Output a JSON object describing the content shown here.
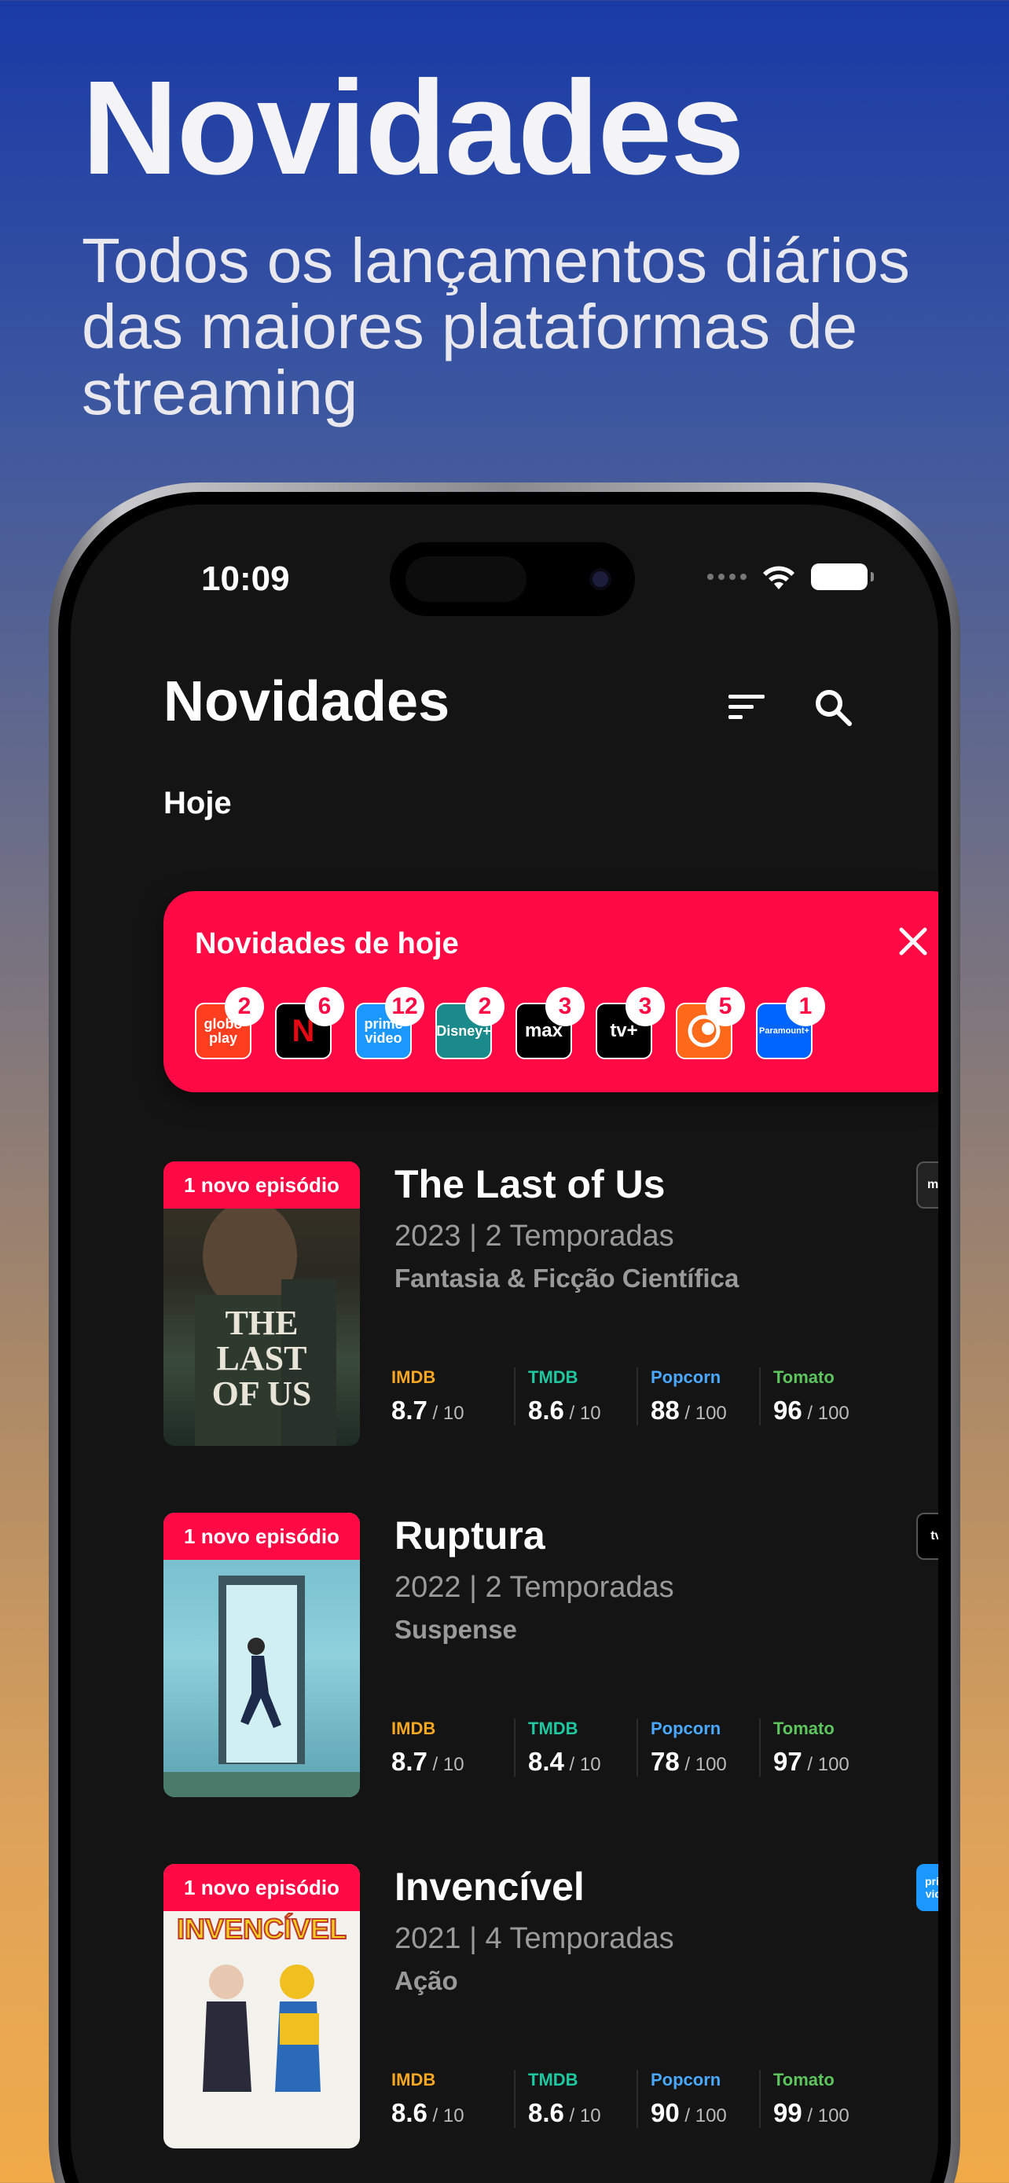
{
  "promo": {
    "title": "Novidades",
    "subtitle": "Todos os lançamentos diários das maiores plataformas de streaming"
  },
  "status_bar": {
    "time": "10:09"
  },
  "header": {
    "title": "Novidades"
  },
  "section": {
    "label": "Hoje"
  },
  "banner": {
    "title": "Novidades de hoje",
    "platforms": [
      {
        "logo": "globo play",
        "count": "2",
        "bg": "#ff3d1f"
      },
      {
        "logo": "N",
        "count": "6",
        "bg": "#000000"
      },
      {
        "logo": "prime video",
        "count": "12",
        "bg": "#1a98ff"
      },
      {
        "logo": "Disney+",
        "count": "2",
        "bg": "#1a8a8a"
      },
      {
        "logo": "max",
        "count": "3",
        "bg": "#000000"
      },
      {
        "logo": "tv+",
        "count": "3",
        "bg": "#000000"
      },
      {
        "logo": "crunchyroll",
        "count": "5",
        "bg": "#ff6a1a"
      },
      {
        "logo": "Paramount+",
        "count": "1",
        "bg": "#0064ff"
      }
    ]
  },
  "shows": [
    {
      "badge": "1 novo episódio",
      "title": "The Last of Us",
      "meta": "2023  |  2 Temporadas",
      "genre": "Fantasia & Ficção Científica",
      "service": "max",
      "ratings": [
        {
          "name": "IMDB",
          "value": "8.7",
          "max": " / 10"
        },
        {
          "name": "TMDB",
          "value": "8.6",
          "max": " / 10"
        },
        {
          "name": "Popcorn",
          "value": "88",
          "max": " / 100"
        },
        {
          "name": "Tomato",
          "value": "96",
          "max": " / 100"
        }
      ]
    },
    {
      "badge": "1 novo episódio",
      "title": "Ruptura",
      "meta": "2022  |  2 Temporadas",
      "genre": "Suspense",
      "service": "tv+",
      "ratings": [
        {
          "name": "IMDB",
          "value": "8.7",
          "max": " / 10"
        },
        {
          "name": "TMDB",
          "value": "8.4",
          "max": " / 10"
        },
        {
          "name": "Popcorn",
          "value": "78",
          "max": " / 100"
        },
        {
          "name": "Tomato",
          "value": "97",
          "max": " / 100"
        }
      ]
    },
    {
      "badge": "1 novo episódio",
      "title": "Invencível",
      "meta": "2021  |  4 Temporadas",
      "genre": "Ação",
      "service": "prime video",
      "ratings": [
        {
          "name": "IMDB",
          "value": "8.6",
          "max": " / 10"
        },
        {
          "name": "TMDB",
          "value": "8.6",
          "max": " / 10"
        },
        {
          "name": "Popcorn",
          "value": "90",
          "max": " / 100"
        },
        {
          "name": "Tomato",
          "value": "99",
          "max": " / 100"
        }
      ]
    }
  ],
  "rating_colors": {
    "IMDB": "#f5a623",
    "TMDB": "#1ec7a0",
    "Popcorn": "#4aa8ff",
    "Tomato": "#5ec45e"
  },
  "colors": {
    "accent": "#ff0a45",
    "screen_bg": "#141414"
  },
  "icons": {
    "sort": "sort-icon",
    "search": "search-icon",
    "close": "close-icon",
    "wifi": "wifi-icon",
    "battery": "battery-icon"
  }
}
